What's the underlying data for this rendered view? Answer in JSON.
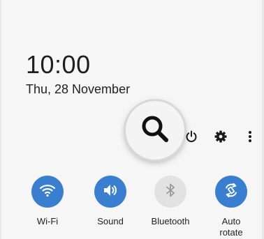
{
  "status": {
    "time": "10:00",
    "date": "Thu, 28 November"
  },
  "toolbar": {
    "search_icon": "search-icon",
    "power_icon": "power-icon",
    "settings_icon": "gear-icon",
    "more_icon": "more-vertical-icon"
  },
  "tiles": [
    {
      "label": "Wi-Fi",
      "icon": "wifi-icon",
      "active": true
    },
    {
      "label": "Sound",
      "icon": "volume-icon",
      "active": true
    },
    {
      "label": "Bluetooth",
      "icon": "bluetooth-icon",
      "active": false
    },
    {
      "label": "Auto\nrotate",
      "icon": "auto-rotate-icon",
      "active": true
    }
  ],
  "colors": {
    "active_tile": "#3a7fcf",
    "inactive_tile": "#e2e2e2"
  }
}
